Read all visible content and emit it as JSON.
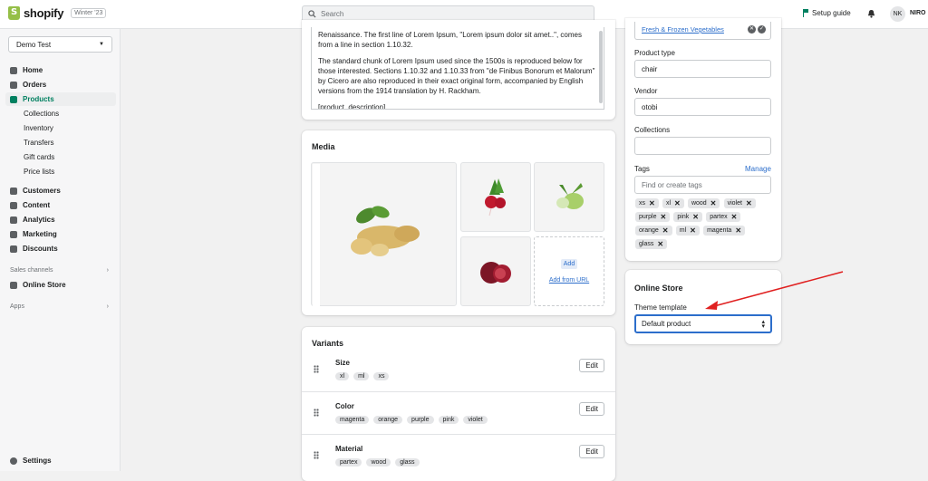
{
  "topbar": {
    "brand": "shopify",
    "badge": "Winter '23",
    "search_placeholder": "Search",
    "setup_guide": "Setup guide",
    "avatar_initials": "NK",
    "user_name": "NIRO"
  },
  "sidebar": {
    "store": "Demo Test",
    "items": [
      {
        "label": "Home"
      },
      {
        "label": "Orders"
      },
      {
        "label": "Products"
      },
      {
        "label": "Collections"
      },
      {
        "label": "Inventory"
      },
      {
        "label": "Transfers"
      },
      {
        "label": "Gift cards"
      },
      {
        "label": "Price lists"
      },
      {
        "label": "Customers"
      },
      {
        "label": "Content"
      },
      {
        "label": "Analytics"
      },
      {
        "label": "Marketing"
      },
      {
        "label": "Discounts"
      }
    ],
    "sales_channels": "Sales channels",
    "online_store": "Online Store",
    "apps": "Apps",
    "settings": "Settings"
  },
  "description": {
    "line0": "Renaissance. The first line of Lorem Ipsum, \"Lorem ipsum dolor sit amet..\", comes from a line in section 1.10.32.",
    "p2": "The standard chunk of Lorem Ipsum used since the 1500s is reproduced below for those interested. Sections 1.10.32 and 1.10.33 from \"de Finibus Bonorum et Malorum\" by Cicero are also reproduced in their exact original form, accompanied by English versions from the 1914 translation by H. Rackham.",
    "p3": "[product_description]"
  },
  "media": {
    "title": "Media",
    "add": "Add",
    "add_from_url": "Add from URL"
  },
  "variants": {
    "title": "Variants",
    "edit": "Edit",
    "options": [
      {
        "name": "Size",
        "values": [
          "xl",
          "ml",
          "xs"
        ]
      },
      {
        "name": "Color",
        "values": [
          "magenta",
          "orange",
          "purple",
          "pink",
          "violet"
        ]
      },
      {
        "name": "Material",
        "values": [
          "partex",
          "wood",
          "glass"
        ]
      }
    ]
  },
  "organization": {
    "category_value": "Fresh & Frozen Vegetables",
    "product_type_label": "Product type",
    "product_type_value": "chair",
    "vendor_label": "Vendor",
    "vendor_value": "otobi",
    "collections_label": "Collections",
    "tags_label": "Tags",
    "manage": "Manage",
    "tags_placeholder": "Find or create tags",
    "tags": [
      "xs",
      "xl",
      "wood",
      "violet",
      "purple",
      "pink",
      "partex",
      "orange",
      "ml",
      "magenta",
      "glass"
    ]
  },
  "online_store": {
    "title": "Online Store",
    "theme_template_label": "Theme template",
    "theme_template_value": "Default product"
  },
  "colors": {
    "accent": "#008060",
    "link": "#2c6ecb",
    "annotation_arrow": "#e02020"
  }
}
